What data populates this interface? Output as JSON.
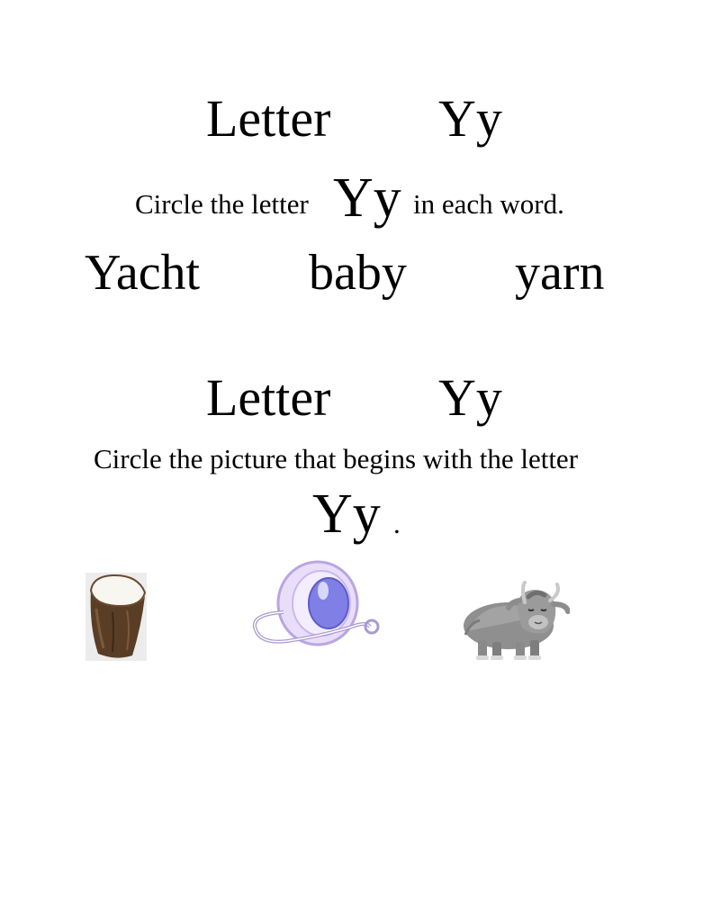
{
  "section1": {
    "title_word": "Letter",
    "title_letter": "Yy",
    "instruction_before": "Circle the letter",
    "instruction_letter": "Yy",
    "instruction_after": "in each word.",
    "words": [
      "Yacht",
      "baby",
      "yarn"
    ]
  },
  "section2": {
    "title_word": "Letter",
    "title_letter": "Yy",
    "instruction": "Circle the picture that begins with the letter",
    "letter": "Yy",
    "period": ".",
    "pictures": [
      "yam-icon",
      "yo-yo-icon",
      "yak-icon"
    ]
  }
}
